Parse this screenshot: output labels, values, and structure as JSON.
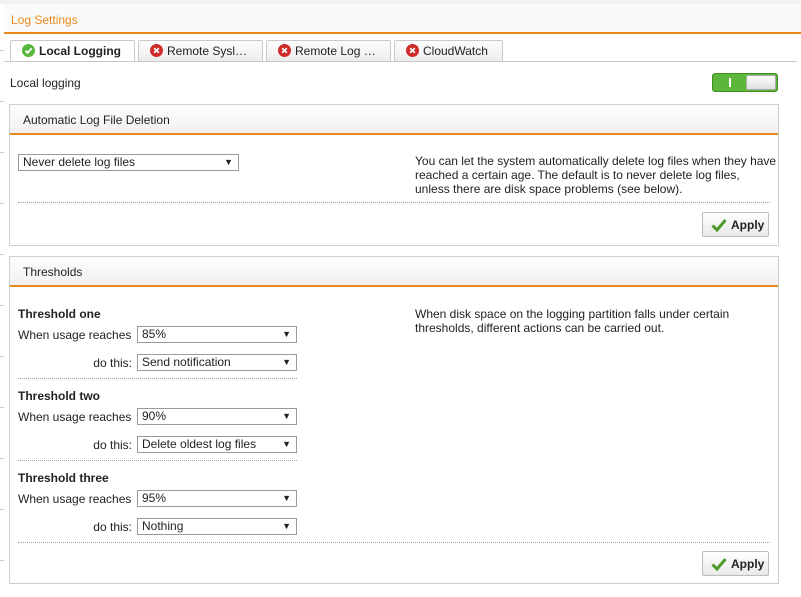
{
  "header": {
    "title": "Log Settings"
  },
  "tabs": [
    {
      "label": "Local Logging",
      "status": "ok",
      "active": true
    },
    {
      "label": "Remote Sysl…",
      "status": "error",
      "active": false
    },
    {
      "label": "Remote Log …",
      "status": "error",
      "active": false
    },
    {
      "label": "CloudWatch",
      "status": "error",
      "active": false
    }
  ],
  "local_logging": {
    "label": "Local logging",
    "enabled": true
  },
  "auto_delete": {
    "title": "Automatic Log File Deletion",
    "selected": "Never delete log files",
    "description": "You can let the system automatically delete log files when they have reached a certain age. The default is to never delete log files, unless there are disk space problems (see below).",
    "apply_label": "Apply"
  },
  "thresholds": {
    "title": "Thresholds",
    "description": "When disk space on the logging partition falls under certain thresholds, different actions can be carried out.",
    "usage_label": "When usage reaches",
    "action_label": "do this:",
    "items": [
      {
        "name": "Threshold one",
        "usage": "85%",
        "action": "Send notification"
      },
      {
        "name": "Threshold two",
        "usage": "90%",
        "action": "Delete oldest log files"
      },
      {
        "name": "Threshold three",
        "usage": "95%",
        "action": "Nothing"
      }
    ],
    "apply_label": "Apply"
  },
  "colors": {
    "accent": "#e8891d",
    "toggle_on": "#5cb63a",
    "error": "#d12b2b",
    "ok": "#58b83d"
  }
}
